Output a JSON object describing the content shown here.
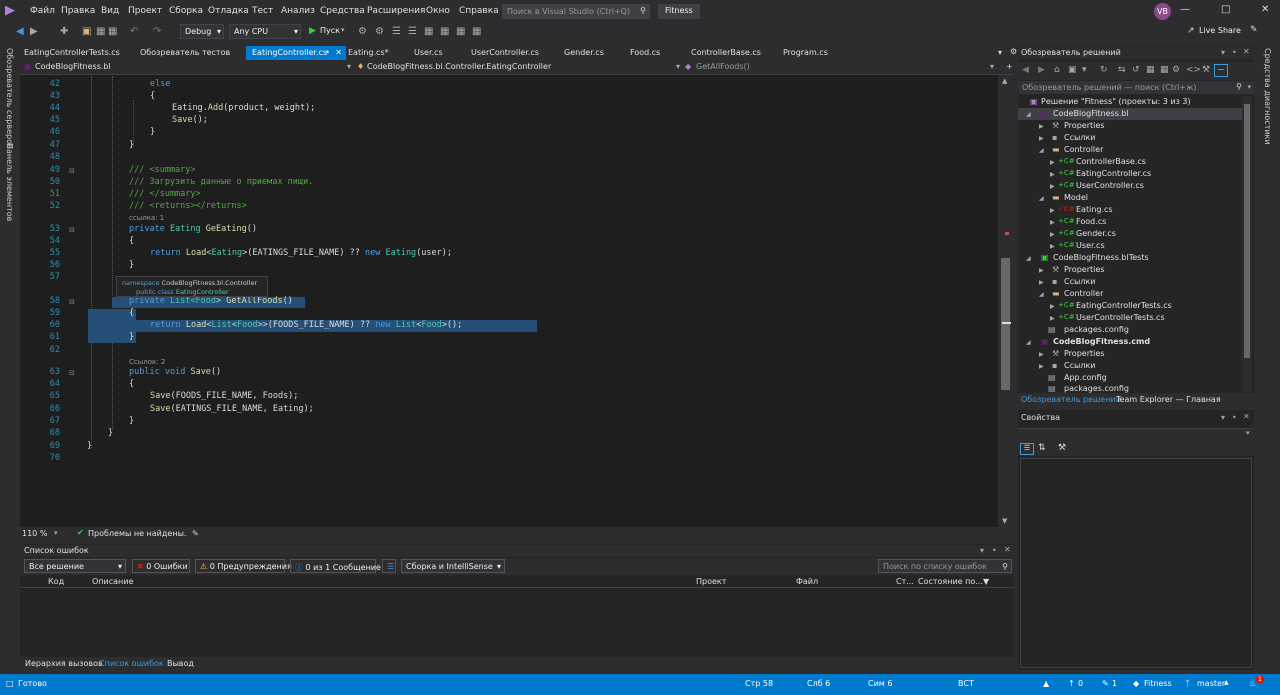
{
  "menu": [
    "Файл",
    "Правка",
    "Вид",
    "Проект",
    "Сборка",
    "Отладка",
    "Тест",
    "Анализ",
    "Средства",
    "Расширения",
    "Окно",
    "Справка"
  ],
  "search_placeholder": "Поиск в Visual Studio (Ctrl+Q)",
  "solution_title": "Fitness",
  "user_initials": "VB",
  "live_share": "Live Share",
  "toolbar": {
    "config": "Debug",
    "platform": "Any CPU",
    "run": "Пуск"
  },
  "left_strip": [
    "Обозреватель серверов",
    "Панель элементов"
  ],
  "right_strip": "Средства диагностики",
  "tabs": [
    "EatingControllerTests.cs",
    "Обозреватель тестов",
    "EatingController.cs",
    "Eating.cs*",
    "User.cs",
    "UserController.cs",
    "Gender.cs",
    "Food.cs",
    "ControllerBase.cs",
    "Program.cs"
  ],
  "navbar": {
    "project": "CodeBlogFitness.bl",
    "class": "CodeBlogFitness.bl.Controller.EatingController",
    "member": "GetAllFoods()"
  },
  "line_numbers": [
    "42",
    "43",
    "44",
    "45",
    "46",
    "47",
    "48",
    "49",
    "50",
    "51",
    "52",
    "53",
    "54",
    "55",
    "56",
    "57",
    "58",
    "59",
    "60",
    "61",
    "62",
    "63",
    "64",
    "65",
    "66",
    "67",
    "68",
    "69",
    "70"
  ],
  "code": {
    "l42": "else",
    "l43": "{",
    "l44a": "Eating.",
    "l44b": "Add",
    "l44c": "(product, weight);",
    "l45a": "Save",
    "l45b": "();",
    "l46": "}",
    "l47": "}",
    "l49": "/// <summary>",
    "l50": "/// Загрузить данные о приемах пищи.",
    "l51": "/// </summary>",
    "l52": "/// <returns></returns>",
    "lens1": "ссылка: 1",
    "l53a": "private",
    "l53b": "Eating",
    "l53c": "GeEating",
    "l53d": "()",
    "l54": "{",
    "l55a": "return",
    "l55b": "Load<",
    "l55c": "Eating",
    "l55d": ">(EATINGS_FILE_NAME) ?? ",
    "l55e": "new",
    "l55f": "Eating",
    "l55g": "(user);",
    "l56": "}",
    "l58a": "private",
    "l58b": "List<",
    "l58c": "Food",
    "l58d": ">",
    "l58e": "GetAllFoods",
    "l58f": "()",
    "l59": "{",
    "l60a": "return",
    "l60b": "Load<",
    "l60c": "List",
    "l60d": "<",
    "l60e": "Food",
    "l60f": ">>(FOODS_FILE_NAME) ?? ",
    "l60g": "new",
    "l60h": "List",
    "l60i": "<",
    "l60j": "Food",
    "l60k": ">();",
    "l61": "}",
    "lens2": "Ссылок: 2",
    "l63a": "public",
    "l63b": "void",
    "l63c": "Save",
    "l63d": "()",
    "l64": "{",
    "l65a": "Save",
    "l65b": "(FOODS_FILE_NAME, Foods);",
    "l66a": "Save",
    "l66b": "(EATINGS_FILE_NAME, Eating);",
    "l67": "}",
    "l68": "}",
    "l69": "}"
  },
  "tooltip": {
    "line1_kw": "namespace",
    "line1": "CodeBlogFitness.bl.Controller",
    "line2_kw": "public class",
    "line2": "EatingController"
  },
  "editor_status": {
    "zoom": "110 %",
    "issues": "Проблемы не найдены."
  },
  "error_list": {
    "title": "Список ошибок",
    "scope": "Все решение",
    "errors": "0 Ошибки",
    "warnings": "0 Предупреждения",
    "messages": "0 из 1 Сообщение",
    "build": "Сборка и IntelliSense",
    "search": "Поиск по списку ошибок",
    "columns": [
      "Код",
      "Описание",
      "Проект",
      "Файл",
      "Ст...",
      "Состояние по..."
    ]
  },
  "bottom_tabs": [
    "Иерархия вызовов",
    "Список ошибок",
    "Вывод"
  ],
  "solution_explorer": {
    "title": "Обозреватель решений",
    "search": "Обозреватель решений — поиск (Ctrl+ж)",
    "items": [
      "Решение \"Fitness\" (проекты: 3 из 3)",
      "CodeBlogFitness.bl",
      "Properties",
      "Ссылки",
      "Controller",
      "ControllerBase.cs",
      "EatingController.cs",
      "UserController.cs",
      "Model",
      "Eating.cs",
      "Food.cs",
      "Gender.cs",
      "User.cs",
      "CodeBlogFitness.blTests",
      "Properties",
      "Ссылки",
      "Controller",
      "EatingControllerTests.cs",
      "UserControllerTests.cs",
      "packages.config",
      "CodeBlogFitness.cmd",
      "Properties",
      "Ссылки",
      "App.config",
      "packages.config"
    ],
    "tabs": [
      "Обозреватель решений",
      "Team Explorer — Главная"
    ]
  },
  "properties": {
    "title": "Свойства"
  },
  "statusbar": {
    "ready": "Готово",
    "line": "Стр 58",
    "col": "Слб 6",
    "char": "Сим 6",
    "ins": "ВСТ",
    "up": "0",
    "pencil": "1",
    "repo": "Fitness",
    "branch": "master",
    "bell": "1"
  },
  "colors": {
    "accent": "#007acc",
    "editor_bg": "#1e1e1e",
    "chrome": "#2d2d30",
    "selection": "#264f78"
  }
}
